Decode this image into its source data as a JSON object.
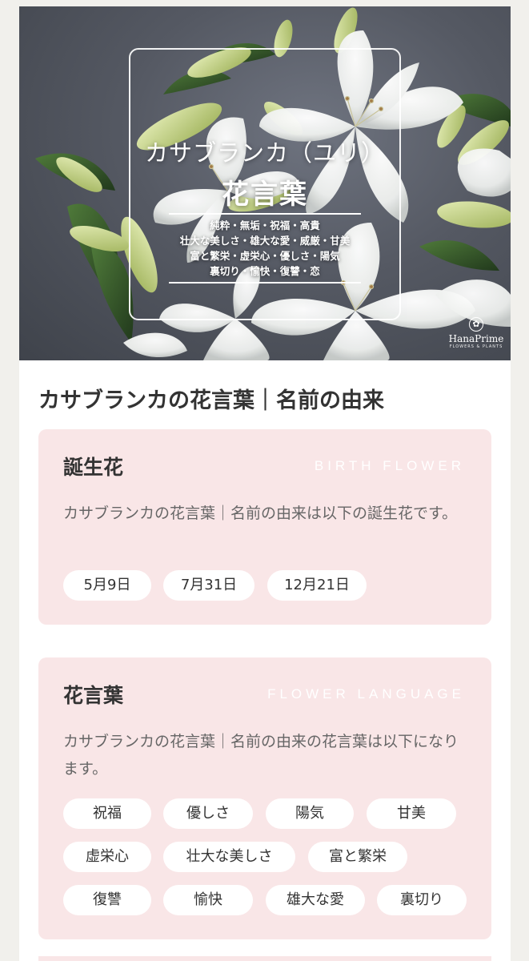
{
  "hero": {
    "title": "カサブランカ（ユリ）",
    "subtitle": "花言葉",
    "words": [
      "純粋・無垢・祝福・高貴",
      "壮大な美しさ・雄大な愛・威厳・甘美",
      "富と繁栄・虚栄心・優しさ・陽気",
      "裏切り・愉快・復讐・恋"
    ],
    "brand_name": "HanaPrime",
    "brand_tagline": "FLOWERS & PLANTS",
    "brand_icon": "flower-logo-icon"
  },
  "main_heading": "カサブランカの花言葉｜名前の由来",
  "birth_card": {
    "title": "誕生花",
    "label_en": "BIRTH FLOWER",
    "description": "カサブランカの花言葉｜名前の由来は以下の誕生花です。",
    "dates": [
      "5月9日",
      "7月31日",
      "12月21日"
    ]
  },
  "language_card": {
    "title": "花言葉",
    "label_en": "FLOWER LANGUAGE",
    "description": "カサブランカの花言葉｜名前の由来の花言葉は以下になります。",
    "words": [
      "祝福",
      "優しさ",
      "陽気",
      "甘美",
      "虚栄心",
      "壮大な美しさ",
      "富と繁栄",
      "復讐",
      "愉快",
      "雄大な愛",
      "裏切り"
    ]
  },
  "colors": {
    "card_background": "#f9e6e7",
    "tag_background": "#ffffff",
    "page_background": "#f1f0ec"
  }
}
